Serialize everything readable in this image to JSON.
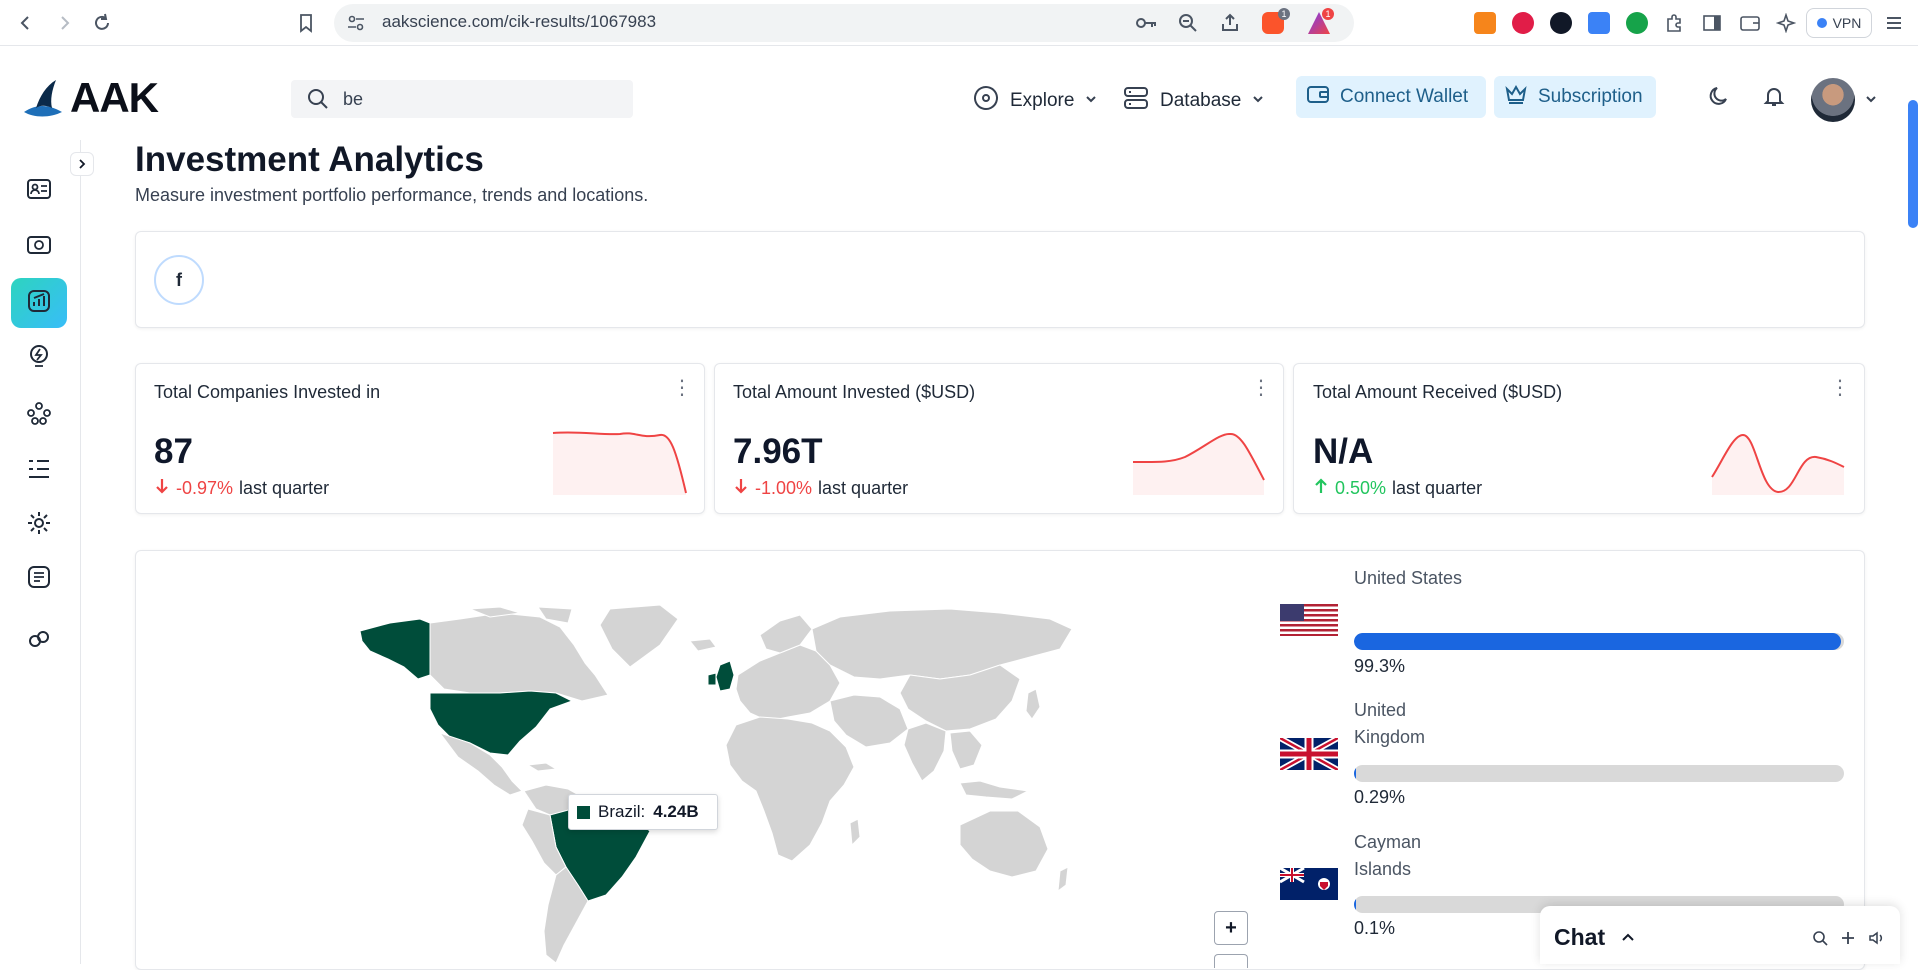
{
  "browser": {
    "url": "aakscience.com/cik-results/1067983",
    "vpn_label": "VPN",
    "brave_badge": "1",
    "alert_badge": "1"
  },
  "header": {
    "logo_text": "AAK",
    "search_value": "be",
    "nav": {
      "explore": "Explore",
      "database": "Database",
      "connect_wallet": "Connect Wallet",
      "subscription": "Subscription"
    }
  },
  "page": {
    "title": "Investment Analytics",
    "subtitle": "Measure investment portfolio performance, trends and locations."
  },
  "social": {
    "facebook_glyph": "f"
  },
  "stats": [
    {
      "title": "Total Companies Invested in",
      "value": "87",
      "change": "-0.97%",
      "direction": "down",
      "suffix": "last quarter"
    },
    {
      "title": "Total Amount Invested ($USD)",
      "value": "7.96T",
      "change": "-1.00%",
      "direction": "down",
      "suffix": "last quarter"
    },
    {
      "title": "Total Amount Received ($USD)",
      "value": "N/A",
      "change": "0.50%",
      "direction": "up",
      "suffix": "last quarter"
    }
  ],
  "map": {
    "tooltip_country": "Brazil:",
    "tooltip_value": "4.24B",
    "highlight_color": "#004d3a",
    "base_color": "#d4d4d4",
    "zoom_in": "+"
  },
  "countries": [
    {
      "name": "United States",
      "pct": "99.3%",
      "share": 99.3
    },
    {
      "name": "United Kingdom",
      "pct": "0.29%",
      "share": 0.29
    },
    {
      "name": "Cayman Islands",
      "pct": "0.1%",
      "share": 0.1
    }
  ],
  "chat": {
    "title": "Chat"
  },
  "colors": {
    "down": "#ef4444",
    "up": "#22c55e",
    "bar": "#1a66e0",
    "accent": "#1e5f8a"
  }
}
